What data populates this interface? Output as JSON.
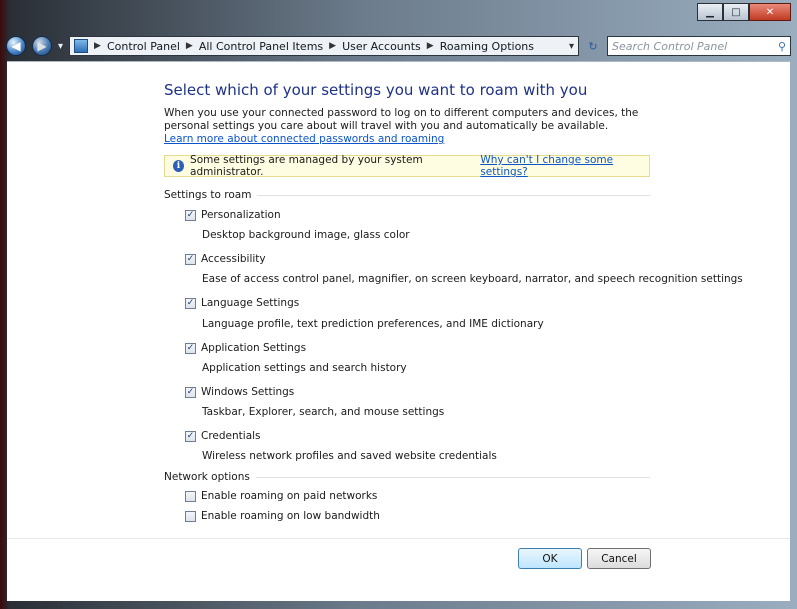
{
  "window": {
    "caption_buttons": [
      {
        "name": "minimize-icon",
        "glyph": "▁"
      },
      {
        "name": "maximize-icon",
        "glyph": "□"
      },
      {
        "name": "close-icon",
        "glyph": "✕"
      }
    ]
  },
  "nav": {
    "back_icon": "back-arrow-icon",
    "forward_icon": "forward-arrow-icon",
    "breadcrumbs": [
      "Control Panel",
      "All Control Panel Items",
      "User Accounts",
      "Roaming Options"
    ],
    "search_placeholder": "Search Control Panel"
  },
  "page": {
    "title": "Select which of your settings you want to roam with you",
    "description": "When you use your connected password to log on to different computers and devices, the personal settings you care about will travel with you and automatically be available.",
    "learn_link": "Learn more about connected passwords and roaming",
    "info_text": "Some settings are managed by your system administrator.",
    "info_link": "Why can't I change some settings?"
  },
  "settings_group": {
    "label": "Settings to roam",
    "items": [
      {
        "label": "Personalization",
        "desc": "Desktop background image, glass color",
        "checked": true
      },
      {
        "label": "Accessibility",
        "desc": "Ease of access control panel, magnifier, on screen keyboard, narrator, and speech recognition settings",
        "checked": true
      },
      {
        "label": "Language Settings",
        "desc": "Language profile, text prediction preferences, and IME dictionary",
        "checked": true
      },
      {
        "label": "Application Settings",
        "desc": "Application settings and search history",
        "checked": true
      },
      {
        "label": "Windows Settings",
        "desc": "Taskbar, Explorer, search, and mouse settings",
        "checked": true
      },
      {
        "label": "Credentials",
        "desc": "Wireless network profiles and saved website credentials",
        "checked": true
      }
    ]
  },
  "network_group": {
    "label": "Network options",
    "items": [
      {
        "label": "Enable roaming on paid networks",
        "checked": false
      },
      {
        "label": "Enable roaming on low bandwidth",
        "checked": false
      }
    ]
  },
  "buttons": {
    "ok": "OK",
    "cancel": "Cancel"
  },
  "colors": {
    "title": "#1e3287",
    "link": "#0b54c9",
    "info_bg": "#fffde1"
  }
}
